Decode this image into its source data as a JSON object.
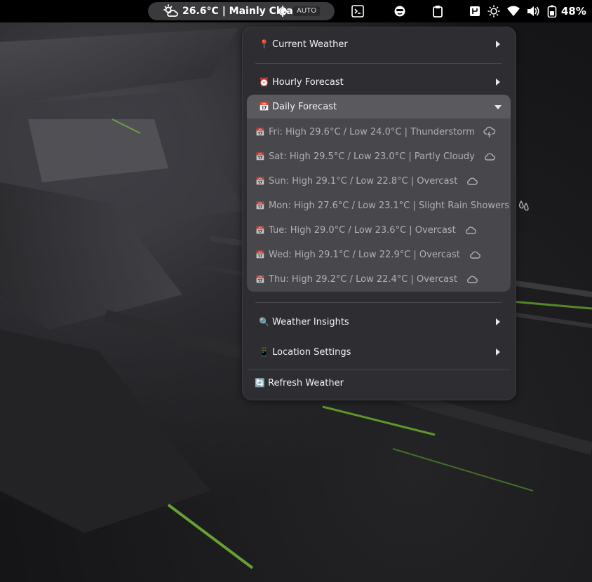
{
  "topbar": {
    "weather_text": "26.6°C | Mainly Clear",
    "weather_icon": "partly-sunny-icon",
    "auto_label": "AUTO",
    "battery_percent": "48%",
    "icons": [
      "terminal-icon",
      "face-icon",
      "clipboard-icon",
      "input-method-icon",
      "brightness-icon",
      "wifi-icon",
      "volume-icon",
      "battery-icon"
    ]
  },
  "menu": {
    "current_weather": {
      "emoji": "📍",
      "label": "Current Weather"
    },
    "hourly_forecast": {
      "emoji": "⏰",
      "label": "Hourly Forecast"
    },
    "daily_forecast": {
      "emoji": "📅",
      "label": "Daily Forecast"
    },
    "days": [
      {
        "emoji": "📅",
        "text": "Fri: High 29.6°C / Low 24.0°C | Thunderstorm",
        "icon": "thunderstorm-icon"
      },
      {
        "emoji": "📅",
        "text": "Sat: High 29.5°C / Low 23.0°C | Partly Cloudy",
        "icon": "cloud-icon"
      },
      {
        "emoji": "📅",
        "text": "Sun: High 29.1°C / Low 22.8°C | Overcast",
        "icon": "cloud-icon"
      },
      {
        "emoji": "📅",
        "text": "Mon: High 27.6°C / Low 23.1°C | Slight Rain Showers",
        "icon": "rain-drops-icon"
      },
      {
        "emoji": "📅",
        "text": "Tue: High 29.0°C / Low 23.6°C | Overcast",
        "icon": "cloud-icon"
      },
      {
        "emoji": "📅",
        "text": "Wed: High 29.1°C / Low 22.9°C | Overcast",
        "icon": "cloud-icon"
      },
      {
        "emoji": "📅",
        "text": "Thu: High 29.2°C / Low 22.4°C | Overcast",
        "icon": "cloud-icon"
      }
    ],
    "weather_insights": {
      "emoji": "🔍",
      "label": "Weather Insights"
    },
    "location_settings": {
      "emoji": "📱",
      "label": "Location Settings"
    },
    "refresh_weather": {
      "emoji": "🔄",
      "label": "Refresh Weather"
    }
  }
}
